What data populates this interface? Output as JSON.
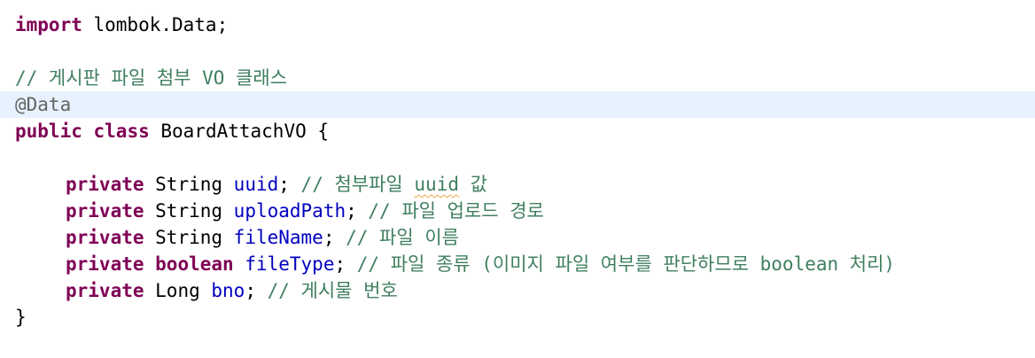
{
  "code": {
    "import_kw": "import",
    "import_rest": " lombok.Data;",
    "class_comment": "// 게시판 파일 첨부 VO 클래스",
    "annotation": "@Data",
    "public_kw": "public",
    "class_kw": "class",
    "class_name": " BoardAttachVO {",
    "closing_brace": "}",
    "fields": [
      {
        "modifier": "private",
        "type": " String ",
        "name": "uuid",
        "semicolon": "; ",
        "comment_pre": "// 첨부파일 ",
        "comment_squiggle": "uuid",
        "comment_post": " 값"
      },
      {
        "modifier": "private",
        "type": " String ",
        "name": "uploadPath",
        "semicolon": "; ",
        "comment": "// 파일 업로드 경로"
      },
      {
        "modifier": "private",
        "type": " String ",
        "name": "fileName",
        "semicolon": "; ",
        "comment": "// 파일 이름"
      },
      {
        "modifier": "private",
        "type_kw": " boolean",
        "name": "fileType",
        "semicolon": "; ",
        "comment": "// 파일 종류 (이미지 파일 여부를 판단하므로 boolean 처리)"
      },
      {
        "modifier": "private",
        "type": " Long ",
        "name": "bno",
        "semicolon": "; ",
        "comment": "// 게시물 번호"
      }
    ]
  },
  "colors": {
    "keyword": "#7f0055",
    "comment": "#3f7f5f",
    "field": "#0000c0",
    "annotation": "#646464",
    "current_line": "#e8f2fe"
  }
}
